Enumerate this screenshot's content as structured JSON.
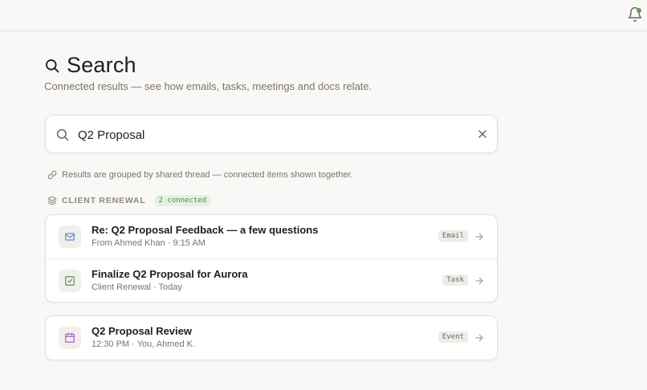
{
  "header": {
    "title": "Search",
    "subtitle": "Connected results — see how emails, tasks, meetings and docs relate."
  },
  "search": {
    "value": "Q2 Proposal",
    "placeholder": ""
  },
  "hint": "Results are grouped by shared thread — connected items shown together.",
  "group": {
    "label": "CLIENT RENEWAL",
    "badge": "2 connected",
    "items": [
      {
        "title": "Re: Q2 Proposal Feedback — a few questions",
        "subtitle": "From Ahmed Khan · 9:15 AM",
        "badge": "Email",
        "icon": "mail-icon"
      },
      {
        "title": "Finalize Q2 Proposal for Aurora",
        "subtitle": "Client Renewal · Today",
        "badge": "Task",
        "icon": "check-square-icon"
      }
    ]
  },
  "standalone": [
    {
      "title": "Q2 Proposal Review",
      "subtitle": "12:30 PM · You, Ahmed K.",
      "badge": "Event",
      "icon": "calendar-icon"
    }
  ],
  "colors": {
    "background": "#f9f8f6",
    "email_icon": "#5b7fd1",
    "task_icon": "#5a8f4e",
    "event_icon": "#a15ad1",
    "notification_dot": "#5aa05a",
    "badge_green_bg": "#e3f1e1"
  }
}
